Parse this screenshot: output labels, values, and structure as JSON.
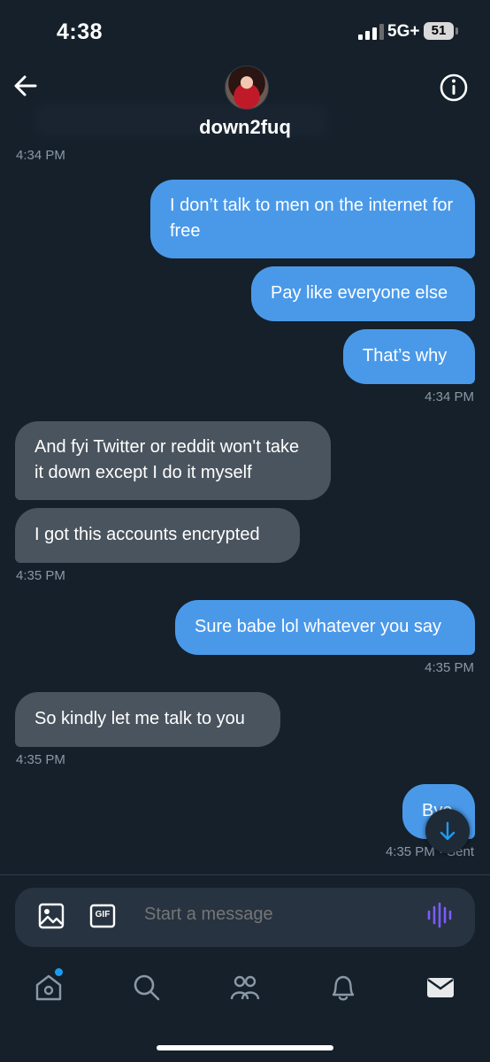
{
  "status_bar": {
    "time": "4:38",
    "network": "5G+",
    "battery": "51"
  },
  "header": {
    "username": "down2fuq"
  },
  "messages": [
    {
      "type": "timestamp",
      "text": "4:34 PM"
    },
    {
      "type": "sent",
      "text": "I don’t talk to men on the internet for free"
    },
    {
      "type": "sent",
      "text": "Pay like everyone else"
    },
    {
      "type": "sent",
      "text": "That’s why"
    },
    {
      "type": "timestamp",
      "text": "4:34 PM"
    },
    {
      "type": "received",
      "text": "And fyi Twitter or reddit won't take it down except I do it myself"
    },
    {
      "type": "received",
      "text": "I got this accounts encrypted"
    },
    {
      "type": "timestamp",
      "text": "4:35 PM"
    },
    {
      "type": "sent",
      "text": "Sure babe lol whatever you say"
    },
    {
      "type": "timestamp",
      "text": "4:35 PM"
    },
    {
      "type": "received",
      "text": "So kindly let me talk to you"
    },
    {
      "type": "timestamp",
      "text": "4:35 PM"
    },
    {
      "type": "sent",
      "text": "Bye"
    },
    {
      "type": "timestamp",
      "text": "4:35 PM · Sent"
    }
  ],
  "composer": {
    "placeholder": "Start a message",
    "gif_label": "GIF"
  },
  "tabs": [
    "home-icon",
    "search-icon",
    "communities-icon",
    "notifications-icon",
    "messages-icon"
  ],
  "colors": {
    "background": "#15202b",
    "sent_bubble": "#4a99e9",
    "received_bubble": "#4a545e",
    "accent": "#1d9bf0",
    "voice": "#7b5cff"
  }
}
